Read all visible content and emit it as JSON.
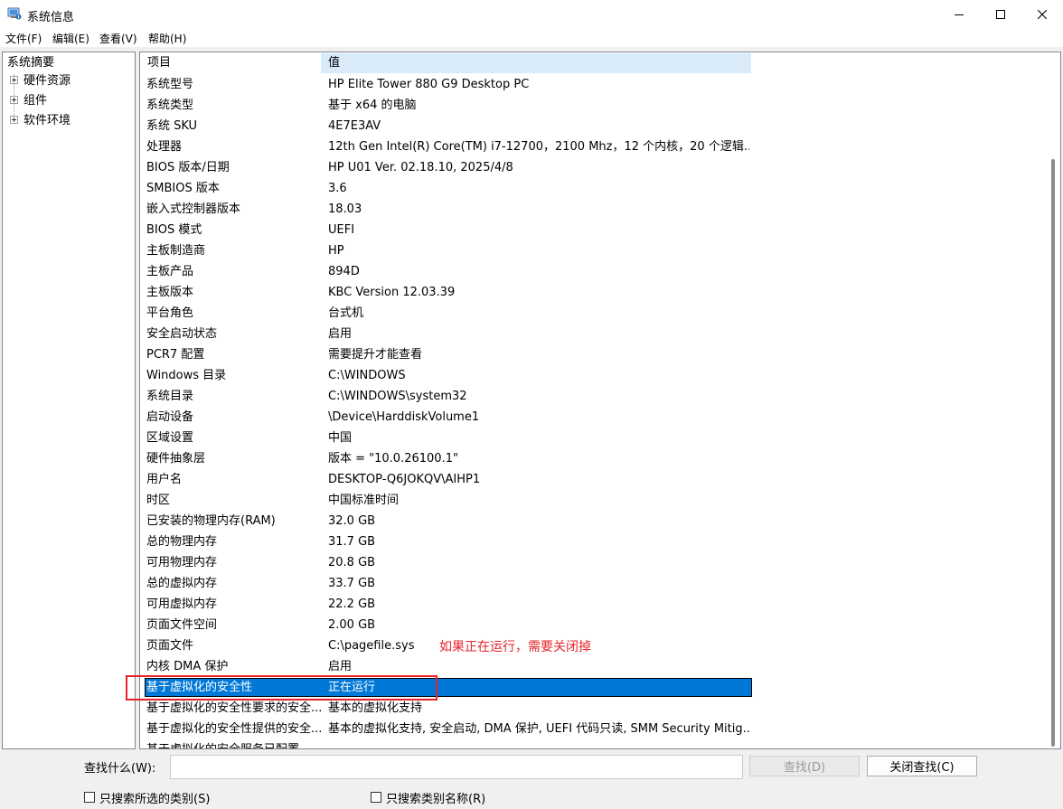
{
  "window": {
    "title": "系统信息"
  },
  "menu": [
    {
      "label": "文件(F)"
    },
    {
      "label": "编辑(E)"
    },
    {
      "label": "查看(V)"
    },
    {
      "label": "帮助(H)"
    }
  ],
  "tree": {
    "root": "系统摘要",
    "children": [
      {
        "label": "硬件资源"
      },
      {
        "label": "组件"
      },
      {
        "label": "软件环境"
      }
    ]
  },
  "list": {
    "col_item": "项目",
    "col_value": "值",
    "selected_index": 29,
    "rows": [
      {
        "item": "系统型号",
        "value": "HP Elite Tower 880 G9 Desktop PC"
      },
      {
        "item": "系统类型",
        "value": "基于 x64 的电脑"
      },
      {
        "item": "系统 SKU",
        "value": "4E7E3AV"
      },
      {
        "item": "处理器",
        "value": "12th Gen Intel(R) Core(TM) i7-12700，2100 Mhz，12 个内核，20 个逻辑..."
      },
      {
        "item": "BIOS 版本/日期",
        "value": "HP U01 Ver. 02.18.10, 2025/4/8"
      },
      {
        "item": "SMBIOS 版本",
        "value": "3.6"
      },
      {
        "item": "嵌入式控制器版本",
        "value": "18.03"
      },
      {
        "item": "BIOS 模式",
        "value": "UEFI"
      },
      {
        "item": "主板制造商",
        "value": "HP"
      },
      {
        "item": "主板产品",
        "value": "894D"
      },
      {
        "item": "主板版本",
        "value": "KBC Version 12.03.39"
      },
      {
        "item": "平台角色",
        "value": "台式机"
      },
      {
        "item": "安全启动状态",
        "value": "启用"
      },
      {
        "item": "PCR7 配置",
        "value": "需要提升才能查看"
      },
      {
        "item": "Windows 目录",
        "value": "C:\\WINDOWS"
      },
      {
        "item": "系统目录",
        "value": "C:\\WINDOWS\\system32"
      },
      {
        "item": "启动设备",
        "value": "\\Device\\HarddiskVolume1"
      },
      {
        "item": "区域设置",
        "value": "中国"
      },
      {
        "item": "硬件抽象层",
        "value": "版本 = \"10.0.26100.1\""
      },
      {
        "item": "用户名",
        "value": "DESKTOP-Q6JOKQV\\AIHP1"
      },
      {
        "item": "时区",
        "value": "中国标准时间"
      },
      {
        "item": "已安装的物理内存(RAM)",
        "value": "32.0 GB"
      },
      {
        "item": "总的物理内存",
        "value": "31.7 GB"
      },
      {
        "item": "可用物理内存",
        "value": "20.8 GB"
      },
      {
        "item": "总的虚拟内存",
        "value": "33.7 GB"
      },
      {
        "item": "可用虚拟内存",
        "value": "22.2 GB"
      },
      {
        "item": "页面文件空间",
        "value": "2.00 GB"
      },
      {
        "item": "页面文件",
        "value": "C:\\pagefile.sys"
      },
      {
        "item": "内核 DMA 保护",
        "value": "启用"
      },
      {
        "item": "基于虚拟化的安全性",
        "value": "正在运行"
      },
      {
        "item": "基于虚拟化的安全性要求的安全...",
        "value": "基本的虚拟化支持"
      },
      {
        "item": "基于虚拟化的安全性提供的安全...",
        "value": "基本的虚拟化支持, 安全启动, DMA 保护, UEFI 代码只读, SMM Security Mitig..."
      },
      {
        "item": "基于虚拟化的安全服务已配置",
        "value": ""
      }
    ]
  },
  "annotation": {
    "text": "如果正在运行，需要关闭掉",
    "color": "#e8232a"
  },
  "find": {
    "label": "查找什么(W):",
    "value": "",
    "find_button": "查找(D)",
    "close_button": "关闭查找(C)",
    "check_selected_category": "只搜索所选的类别(S)",
    "check_category_names": "只搜索类别名称(R)"
  },
  "colors": {
    "selection": "#0078d7",
    "header_value_bg": "#d9ebf9"
  }
}
